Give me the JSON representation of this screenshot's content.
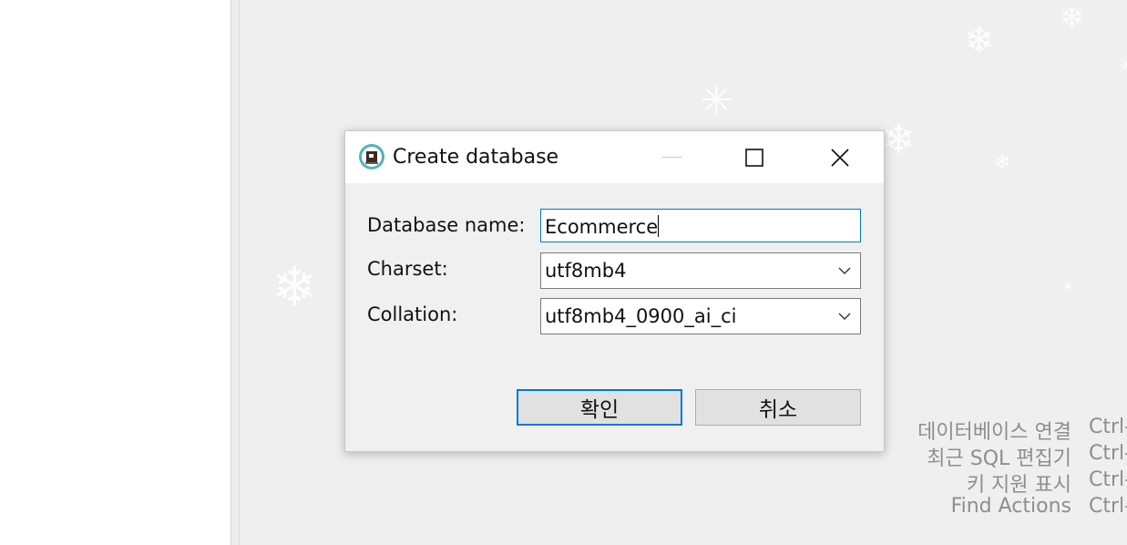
{
  "dialog": {
    "title": "Create database",
    "fields": {
      "database_name": {
        "label": "Database name:",
        "value": "Ecommerce"
      },
      "charset": {
        "label": "Charset:",
        "value": "utf8mb4"
      },
      "collation": {
        "label": "Collation:",
        "value": "utf8mb4_0900_ai_ci"
      }
    },
    "buttons": {
      "ok": "확인",
      "cancel": "취소"
    }
  },
  "shortcuts": [
    {
      "label": "데이터베이스 연결",
      "key": "Ctrl-"
    },
    {
      "label": "최근 SQL 편집기",
      "key": "Ctrl-"
    },
    {
      "label": "키 지원 표시",
      "key": "Ctrl-"
    },
    {
      "label": "Find Actions",
      "key": "Ctrl-"
    }
  ],
  "colors": {
    "focus_border": "#0078d7",
    "background": "#efefef"
  }
}
